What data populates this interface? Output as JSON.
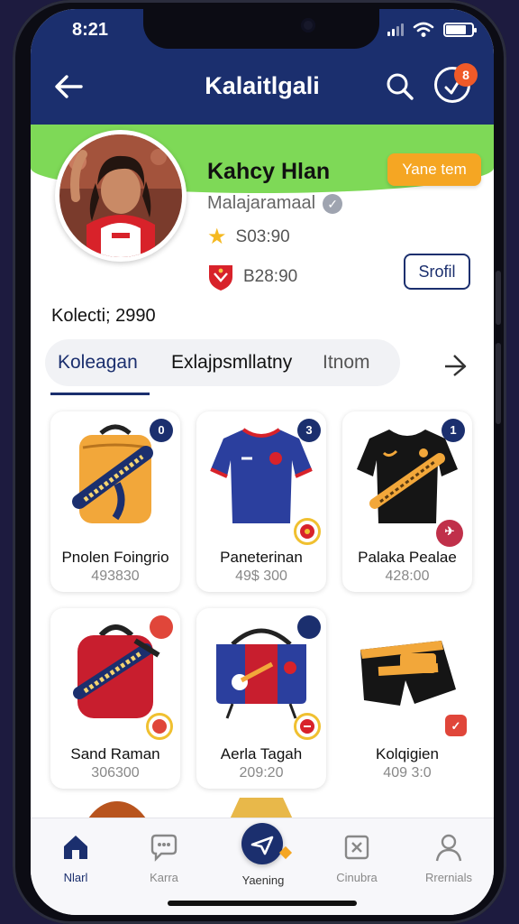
{
  "status_bar": {
    "time": "8:21"
  },
  "header": {
    "title": "Kalaitlgali",
    "notification_count": "8"
  },
  "profile": {
    "name": "Kahcy Hlan",
    "handle": "Malajaramaal",
    "stat_points": "S03:90",
    "stat_club": "B28:90",
    "follow_label": "Yane tem",
    "profile_button_label": "Srofil",
    "collection_count": "Kolecti; 2990"
  },
  "tabs": [
    {
      "label": "Koleagan",
      "active": true
    },
    {
      "label": "Exlajpsmllatny",
      "active": false
    },
    {
      "label": "Itnom",
      "active": false
    }
  ],
  "items": [
    {
      "name": "Pnolen Foingrio",
      "price": "493830",
      "badge": "0"
    },
    {
      "name": "Paneterinan",
      "price": "49$ 300",
      "badge": "3"
    },
    {
      "name": "Palaka Pealae",
      "price": "428:00",
      "badge": "1"
    },
    {
      "name": "Sand Raman",
      "price": "306300",
      "badge": ""
    },
    {
      "name": "Aerla Tagah",
      "price": "209:20",
      "badge": ""
    },
    {
      "name": "Kolqigien",
      "price": "409 3:0",
      "badge": ""
    }
  ],
  "bottom_nav": [
    {
      "label": "Nlarl"
    },
    {
      "label": "Karra"
    },
    {
      "label": "Yaening"
    },
    {
      "label": "Cinubra"
    },
    {
      "label": "Rrernials"
    }
  ],
  "colors": {
    "header": "#1b2f6e",
    "accent_green": "#7ed957",
    "accent_orange": "#f5a623",
    "badge_red": "#e0463a"
  }
}
